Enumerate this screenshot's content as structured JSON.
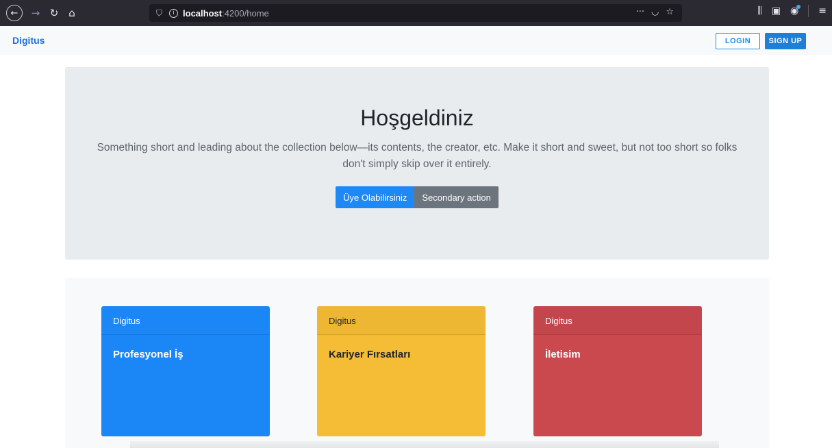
{
  "browser": {
    "url_host": "localhost",
    "url_path": ":4200/home",
    "icons": [
      "back-icon",
      "forward-icon",
      "reload-icon",
      "home-icon",
      "shield-icon",
      "info-icon",
      "more-icon",
      "pocket-icon",
      "bookmark-star-icon",
      "library-icon",
      "reader-icon",
      "account-icon",
      "menu-icon"
    ]
  },
  "navbar": {
    "brand": "Digitus",
    "login_label": "LOGIN",
    "signup_label": "SIGN UP"
  },
  "jumbotron": {
    "title": "Hoşgeldiniz",
    "lead": "Something short and leading about the collection below—its contents, the creator, etc. Make it short and sweet, but not too short so folks don't simply skip over it entirely.",
    "primary_label": "Üye Olabilirsiniz",
    "secondary_label": "Secondary action"
  },
  "cards": [
    {
      "header": "Digitus",
      "title": "Profesyonel İş",
      "color": "#1b86f5"
    },
    {
      "header": "Digitus",
      "title": "Kariyer Fırsatları",
      "color": "#f5bd35"
    },
    {
      "header": "Digitus",
      "title": "İletisim",
      "color": "#c9494f"
    }
  ],
  "colors": {
    "accent": "#1e88e5",
    "secondary": "#6c757d",
    "jumbotron_bg": "#e9ecef"
  }
}
